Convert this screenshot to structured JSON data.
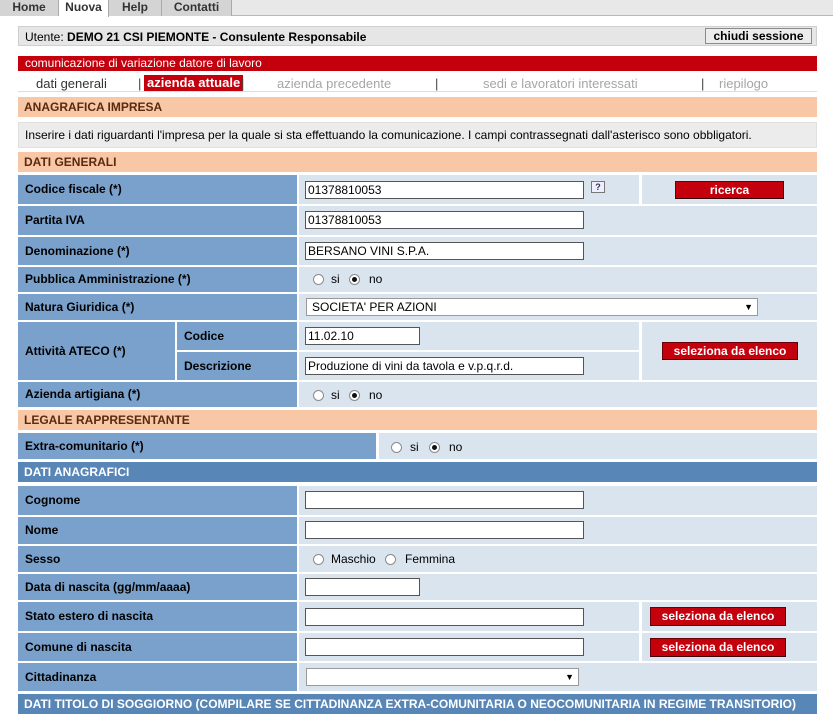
{
  "nav": {
    "tabs": [
      "Home",
      "Nuova",
      "Help",
      "Contatti"
    ],
    "active": "Nuova"
  },
  "user": {
    "label": "Utente:",
    "value": "DEMO 21 CSI PIEMONTE - Consulente Responsabile",
    "logout": "chiudi sessione"
  },
  "title": "comunicazione di variazione datore di lavoro",
  "steps": [
    "dati generali",
    "azienda attuale",
    "azienda precedente",
    "sedi e lavoratori interessati",
    "riepilogo"
  ],
  "current_step": "azienda attuale",
  "sections": {
    "anagrafica": "ANAGRAFICA IMPRESA",
    "info": "Inserire i dati riguardanti l'impresa per la quale si sta effettuando la comunicazione. I campi contrassegnati dall'asterisco sono obbligatori.",
    "dati_generali": "DATI GENERALI",
    "legale": "LEGALE RAPPRESENTANTE",
    "dati_anagrafici": "DATI ANAGRAFICI",
    "soggiorno": "DATI TITOLO DI SOGGIORNO (COMPILARE SE CITTADINANZA EXTRA-COMUNITARIA O NEOCOMUNITARIA IN REGIME TRANSITORIO)"
  },
  "company": {
    "codice_fiscale_label": "Codice fiscale (*)",
    "codice_fiscale": "01378810053",
    "help": "?",
    "ricerca": "ricerca",
    "piva_label": "Partita IVA",
    "piva": "01378810053",
    "denominazione_label": "Denominazione (*)",
    "denominazione": "BERSANO VINI S.P.A.",
    "pa_label": "Pubblica Amministrazione (*)",
    "natura_label": "Natura Giuridica (*)",
    "natura": "SOCIETA' PER AZIONI",
    "ateco_label": "Attività ATECO (*)",
    "codice_label": "Codice",
    "codice": "11.02.10",
    "descrizione_label": "Descrizione",
    "descrizione": "Produzione di vini da tavola e v.p.q.r.d.",
    "seleziona": "seleziona da elenco",
    "artigiana_label": "Azienda artigiana (*)"
  },
  "radio": {
    "si": "si",
    "no": "no",
    "maschio": "Maschio",
    "femmina": "Femmina"
  },
  "legale": {
    "extra_label": "Extra-comunitario (*)",
    "cognome_label": "Cognome",
    "cognome": "",
    "nome_label": "Nome",
    "nome": "",
    "sesso_label": "Sesso",
    "nascita_label": "Data di nascita (gg/mm/aaaa)",
    "nascita": "",
    "stato_label": "Stato estero di nascita",
    "stato": "",
    "comune_label": "Comune di nascita",
    "comune": "",
    "cittadinanza_label": "Cittadinanza",
    "cittadinanza": ""
  },
  "colors": {
    "accent": "#c4000d",
    "label_bg": "#7aa1cc",
    "value_bg": "#d9e4ef",
    "section_orange": "#f8c7a5",
    "section_blue": "#5886b6"
  }
}
